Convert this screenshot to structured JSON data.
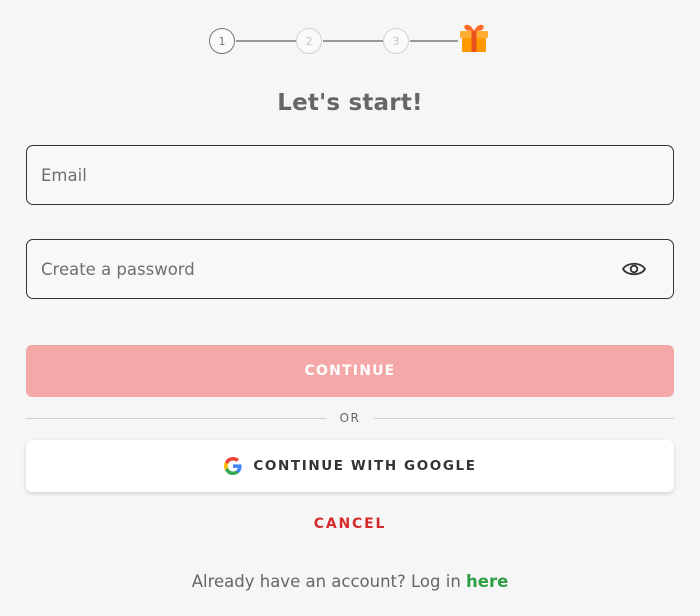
{
  "stepper": {
    "steps": [
      "1",
      "2",
      "3"
    ],
    "active_step": 1,
    "gift_icon": "gift-icon"
  },
  "title": "Let's start!",
  "email": {
    "placeholder": "Email",
    "value": ""
  },
  "password": {
    "placeholder": "Create a password",
    "value": "",
    "toggle_icon": "eye-icon"
  },
  "continue_label": "CONTINUE",
  "or_label": "OR",
  "google": {
    "label": "CONTINUE WITH GOOGLE",
    "icon": "google-icon"
  },
  "cancel_label": "CANCEL",
  "login": {
    "prompt": "Already have an account? Log in ",
    "link": "here"
  },
  "colors": {
    "continue_bg": "#f4a8a8",
    "cancel": "#d62b2b",
    "link": "#2f9e44"
  }
}
